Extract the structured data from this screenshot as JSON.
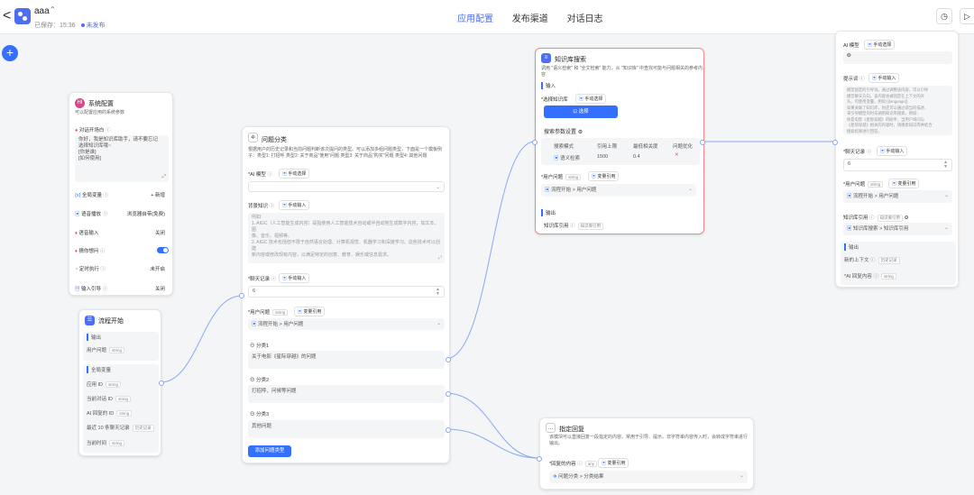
{
  "header": {
    "back": "<",
    "app_name": "aaa",
    "saved": "已保存：15:36",
    "publish_status": "未发布",
    "tabs": [
      {
        "label": "应用配置"
      },
      {
        "label": "发布渠道"
      },
      {
        "label": "对话日志"
      }
    ]
  },
  "system_node": {
    "title": "系统配置",
    "desc": "可以配置应用的系统参数",
    "opening_label": "对话开场白",
    "opening_text": [
      "你好，我是知识库助手，请不要忘记",
      "选择知识库哦~",
      "[你是谁]",
      "[如何使用]"
    ],
    "rows": [
      {
        "label": "全局变量",
        "value": "+ 新增"
      },
      {
        "label": "语音播放",
        "value": "浏览器自带(免费)"
      },
      {
        "label": "语音输入",
        "value": "关闭"
      },
      {
        "label": "猜你想问",
        "value": ""
      },
      {
        "label": "定时执行",
        "value": "未开启"
      },
      {
        "label": "输入引导",
        "value": "关闭"
      }
    ]
  },
  "start_node": {
    "title": "流程开始",
    "output_label": "输出",
    "output_item": "用户问题",
    "global_label": "全局变量",
    "globals": [
      "应用 ID",
      "当前对话 ID",
      "AI 回复的 ID",
      "最近 10 条聊天记录",
      "当前时间"
    ],
    "string_tag": "string",
    "history_tag": "历史记录"
  },
  "classify_node": {
    "title": "问题分类",
    "desc": [
      "根据用户的历史记录和当前问题判断该次提问的类型。可以添加多组问题类型，下面是一个模板例",
      "子：类型1: 打招呼 类型2: 关于商品\"使用\"问题 类型3: 关于商品\"购买\"问题 类型4: 其他问题"
    ],
    "ai_model_label": "AI 模型",
    "manual_input": "手动选择",
    "bg_label": "背景知识",
    "bg_manual": "手动输入",
    "bg_text": [
      "例如:",
      "1. AIGC（人工智能生成内容）是指使用人工智能技术自动或半自动地生成数字内容，如文本、图",
      "像、音乐、视频等。",
      "2. AIGC 技术包括但不限于自然语言处理、计算机视觉、机器学习和深度学习。这些技术可以创建",
      "新内容或修改现有内容，以满足特定的创意、教育、娱乐或信息需求。"
    ],
    "history_label": "聊天记录",
    "history_manual": "手动输入",
    "history_value": "6",
    "question_label": "用户问题",
    "string_tag": "string",
    "var_ref": "变量引用",
    "question_value": "流程开始 > 用户问题",
    "categories": [
      {
        "label": "分类1",
        "text": "关于电影《星际穿越》的问题"
      },
      {
        "label": "分类2",
        "text": "打招呼、问候等问题"
      },
      {
        "label": "分类3",
        "text": "其他问题"
      }
    ],
    "add_button": "添加问题类型"
  },
  "kb_node": {
    "title": "知识库搜索",
    "desc": "调用 \"语义检索\" 和 \"全文检索\" 能力，从 \"知识库\" 中查找可能与问题相关的参考内容",
    "input_label": "输入",
    "select_kb_label": "选择知识库",
    "manual_select": "手动选择",
    "select_btn": "选择",
    "search_settings": "搜索参数设置",
    "table_headers": [
      "搜索模式",
      "引用上限",
      "最低相关度",
      "问题优化"
    ],
    "table_row": [
      "语义检索",
      "1500",
      "0.4",
      "✕"
    ],
    "question_label": "用户问题",
    "string_tag": "string",
    "var_ref": "变量引用",
    "question_value": "流程开始 > 用户问题",
    "output_label": "输出",
    "output_item": "知识库引用",
    "output_tag": "知识库引用"
  },
  "ai_node": {
    "model_label": "AI 模型",
    "manual_select": "手动选择",
    "prompt_label": "提示词",
    "prompt_manual": "手动输入",
    "prompt_text": [
      "模型固定的引导词，通过调整该内容，可以引导",
      "模型聊天方向。该内容会被固定在上下文的开",
      "头。可使用变量，例如 {{language}}",
      "如果关联了知识库，你还可以通过适当的描述，",
      "来引导模型何时去调用知识库搜索。例如：",
      "你是电影《星际穿越》的助手，当用户询问与",
      "《星际穿越》相关的内容时，请搜索知识库并结合",
      "搜索结果进行回答。"
    ],
    "history_label": "聊天记录",
    "history_manual": "手动输入",
    "history_value": "6",
    "question_label": "用户问题",
    "string_tag": "string",
    "var_ref": "变量引用",
    "question_value": "流程开始 > 用户问题",
    "kb_ref_label": "知识库引用",
    "kb_ref_tag": "知识库引用",
    "kb_ref_value": "知识库搜索 > 知识库引用",
    "output_label": "输出",
    "outputs": [
      {
        "name": "新的上下文",
        "tag": "历史记录"
      },
      {
        "name": "AI 回复内容",
        "tag": "string"
      }
    ]
  },
  "reply_node": {
    "title": "指定回复",
    "desc": [
      "该模块可以直接回复一段指定的内容。常用于引导、提示。非字符串内容传入时，会转成字符串进行",
      "输出。"
    ],
    "content_label": "回复的内容",
    "any_tag": "any",
    "var_ref": "变量引用",
    "content_value": "问题分类 > 分类结果"
  },
  "colors": {
    "accent": "#3370ff",
    "edge": "#8aa8f0"
  }
}
